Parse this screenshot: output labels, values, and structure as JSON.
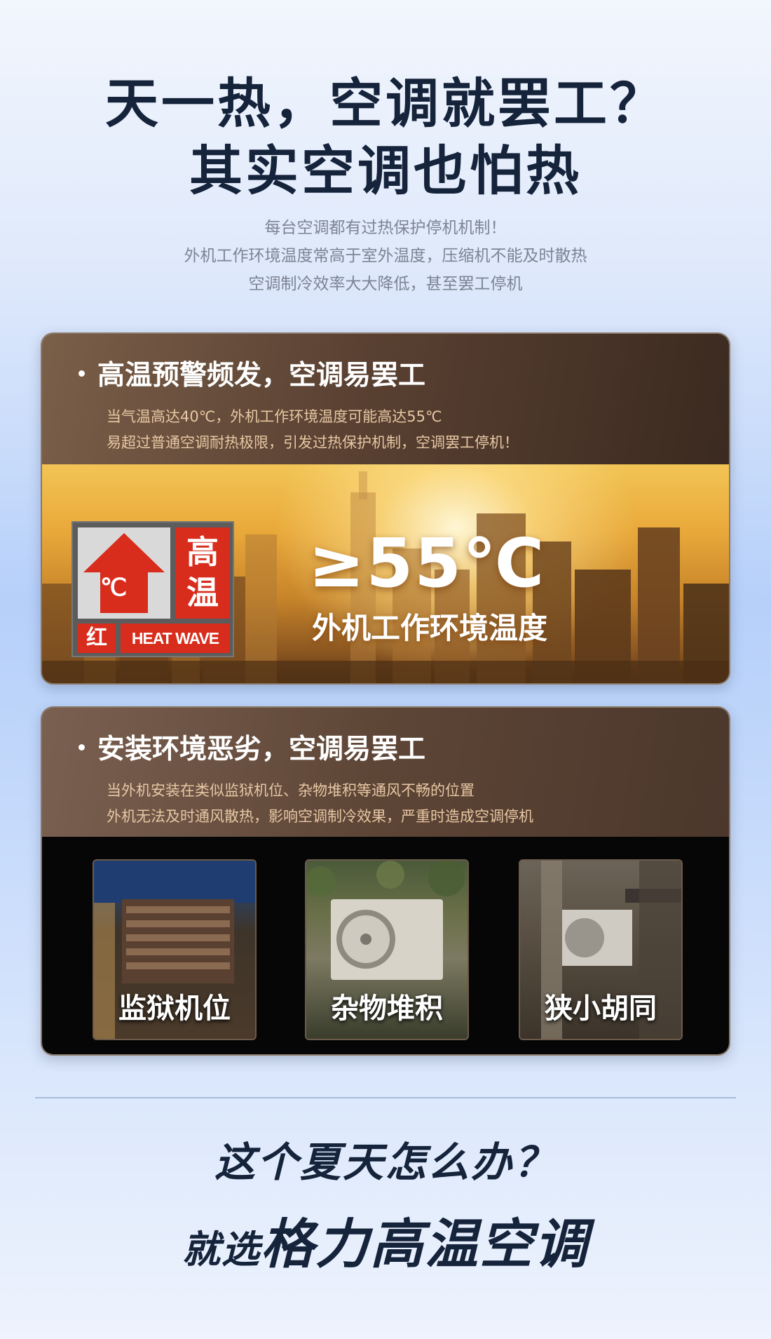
{
  "hero": {
    "line1": "天一热，空调就罢工？",
    "line2": "其实空调也怕热"
  },
  "intro": [
    "每台空调都有过热保护停机机制！",
    "外机工作环境温度常高于室外温度，压缩机不能及时散热",
    "空调制冷效率大大降低，甚至罢工停机"
  ],
  "card1": {
    "title": "高温预警频发，空调易罢工",
    "desc": [
      "当气温高达40℃，外机工作环境温度可能高达55℃",
      "易超过普通空调耐热极限，引发过热保护机制，空调罢工停机！"
    ],
    "badge": {
      "deg": "℃",
      "chars": "高温",
      "level": "红",
      "english": "HEAT WAVE"
    },
    "temp": "≥55℃",
    "temp_caption": "外机工作环境温度"
  },
  "card2": {
    "title": "安装环境恶劣，空调易罢工",
    "desc": [
      "当外机安装在类似监狱机位、杂物堆积等通风不畅的位置",
      "外机无法及时通风散热，影响空调制冷效果，严重时造成空调停机"
    ],
    "tiles": [
      "监狱机位",
      "杂物堆积",
      "狭小胡同"
    ]
  },
  "footer": {
    "question": "这个夏天怎么办？",
    "answer_prefix": "就选",
    "answer_main": "格力高温空调"
  },
  "colors": {
    "navy": "#15233b",
    "card_head": "#5a4132",
    "desc_gold": "#e7c8a4",
    "alert_red": "#d82c1c"
  }
}
